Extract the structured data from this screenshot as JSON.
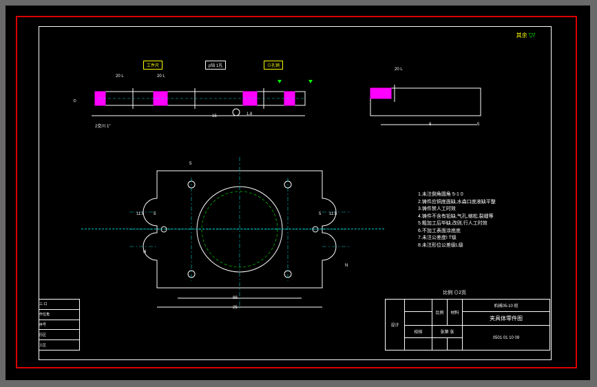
{
  "balloon_label": "其余",
  "callouts": {
    "a": "工件尺",
    "b": "p钻 1孔",
    "c": "⊙孔销"
  },
  "dims": {
    "d1": "20 L",
    "d2": "20 L",
    "d3": "20 L",
    "d4": "20 L",
    "w1": "2交川 1\"",
    "w2": "11.5",
    "w3": "11.5",
    "w4": "5",
    "w5": "5",
    "ref_a": "⊙",
    "ref_b": "8",
    "plan_h": "89",
    "plan_w": "25",
    "top_l": "15",
    "top_r": "1.8",
    "arrow_a": "N",
    "arrow_b": "N"
  },
  "scale_label": "比例 ⊙2页",
  "notes": [
    "1.未注倒角圆角 5-1 0",
    "2.铸件应铜底面缺,水森口底液缺平整",
    "3.铸件禁人工时效",
    "4.铸件不含有铅缺,气孔,缩松,裂缝等",
    "5.粗加工后毕缺,改则,行人工时效",
    "6.不加工表面涂底底",
    "7.未注公差度I T级",
    "8.未注形位公差级L级"
  ],
  "titleblock": {
    "class": "机械05-10 班",
    "title": "夹具体零件图",
    "partno": "0501 01 10 09",
    "design_label": "设计",
    "check_label": "校核",
    "scale_col": "比例",
    "material_col": "材料",
    "page": "张第 张"
  },
  "revblock": {
    "r1": "三·口",
    "r2": "作位角",
    "r3": "序号",
    "r4": "历区",
    "r5": "工区"
  }
}
